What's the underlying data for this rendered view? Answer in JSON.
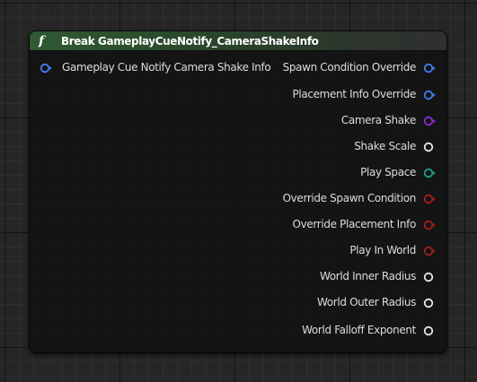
{
  "node": {
    "title": "Break GameplayCueNotify_CameraShakeInfo",
    "icon": "function-icon",
    "header_color": "#2f5a32",
    "input": {
      "label": "Gameplay Cue Notify Camera Shake Info",
      "pin_color": "#3f7ff0"
    },
    "outputs": [
      {
        "label": "Spawn Condition Override",
        "pin_color": "#3f7ff0",
        "shape": "arrow"
      },
      {
        "label": "Placement Info Override",
        "pin_color": "#3f7ff0",
        "shape": "arrow"
      },
      {
        "label": "Camera Shake",
        "pin_color": "#8a2be2",
        "shape": "arrow"
      },
      {
        "label": "Shake Scale",
        "pin_color": "#e6e6e6",
        "shape": "plain"
      },
      {
        "label": "Play Space",
        "pin_color": "#1aa08c",
        "shape": "arrow"
      },
      {
        "label": "Override Spawn Condition",
        "pin_color": "#a51c1c",
        "shape": "arrow"
      },
      {
        "label": "Override Placement Info",
        "pin_color": "#a51c1c",
        "shape": "arrow"
      },
      {
        "label": "Play In World",
        "pin_color": "#a51c1c",
        "shape": "arrow"
      },
      {
        "label": "World Inner Radius",
        "pin_color": "#e6e6e6",
        "shape": "plain"
      },
      {
        "label": "World Outer Radius",
        "pin_color": "#e6e6e6",
        "shape": "plain"
      },
      {
        "label": "World Falloff Exponent",
        "pin_color": "#e6e6e6",
        "shape": "plain"
      }
    ]
  }
}
